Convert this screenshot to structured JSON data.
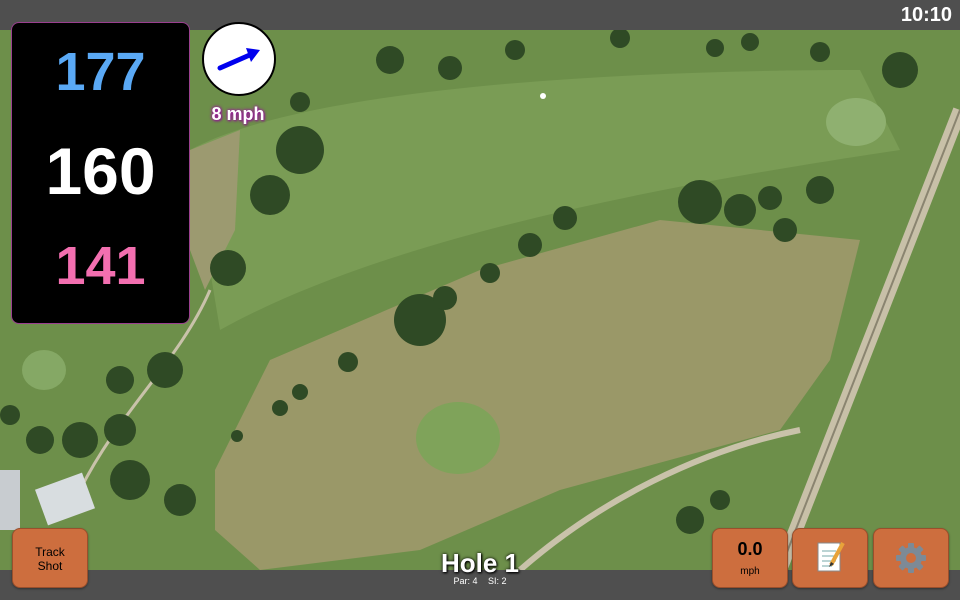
{
  "status_bar": {
    "time": "10:10"
  },
  "distances": {
    "back": "177",
    "middle": "160",
    "front": "141"
  },
  "wind": {
    "speed": "8 mph",
    "icon": "wind-arrow-icon"
  },
  "hole": {
    "title": "Hole 1",
    "par": "Par: 4",
    "stroke_index": "SI: 2"
  },
  "buttons": {
    "track_shot": {
      "line1": "Track",
      "line2": "Shot"
    },
    "speed": {
      "value": "0.0",
      "unit": "mph"
    },
    "notes": {
      "icon": "notepad-icon"
    },
    "settings": {
      "icon": "gear-icon"
    }
  },
  "colors": {
    "back_distance": "#5aa9f5",
    "middle_distance": "#ffffff",
    "front_distance": "#f36fb0",
    "button_bg": "#cd6e3e",
    "wind_text_glow": "#9a1f9a"
  }
}
